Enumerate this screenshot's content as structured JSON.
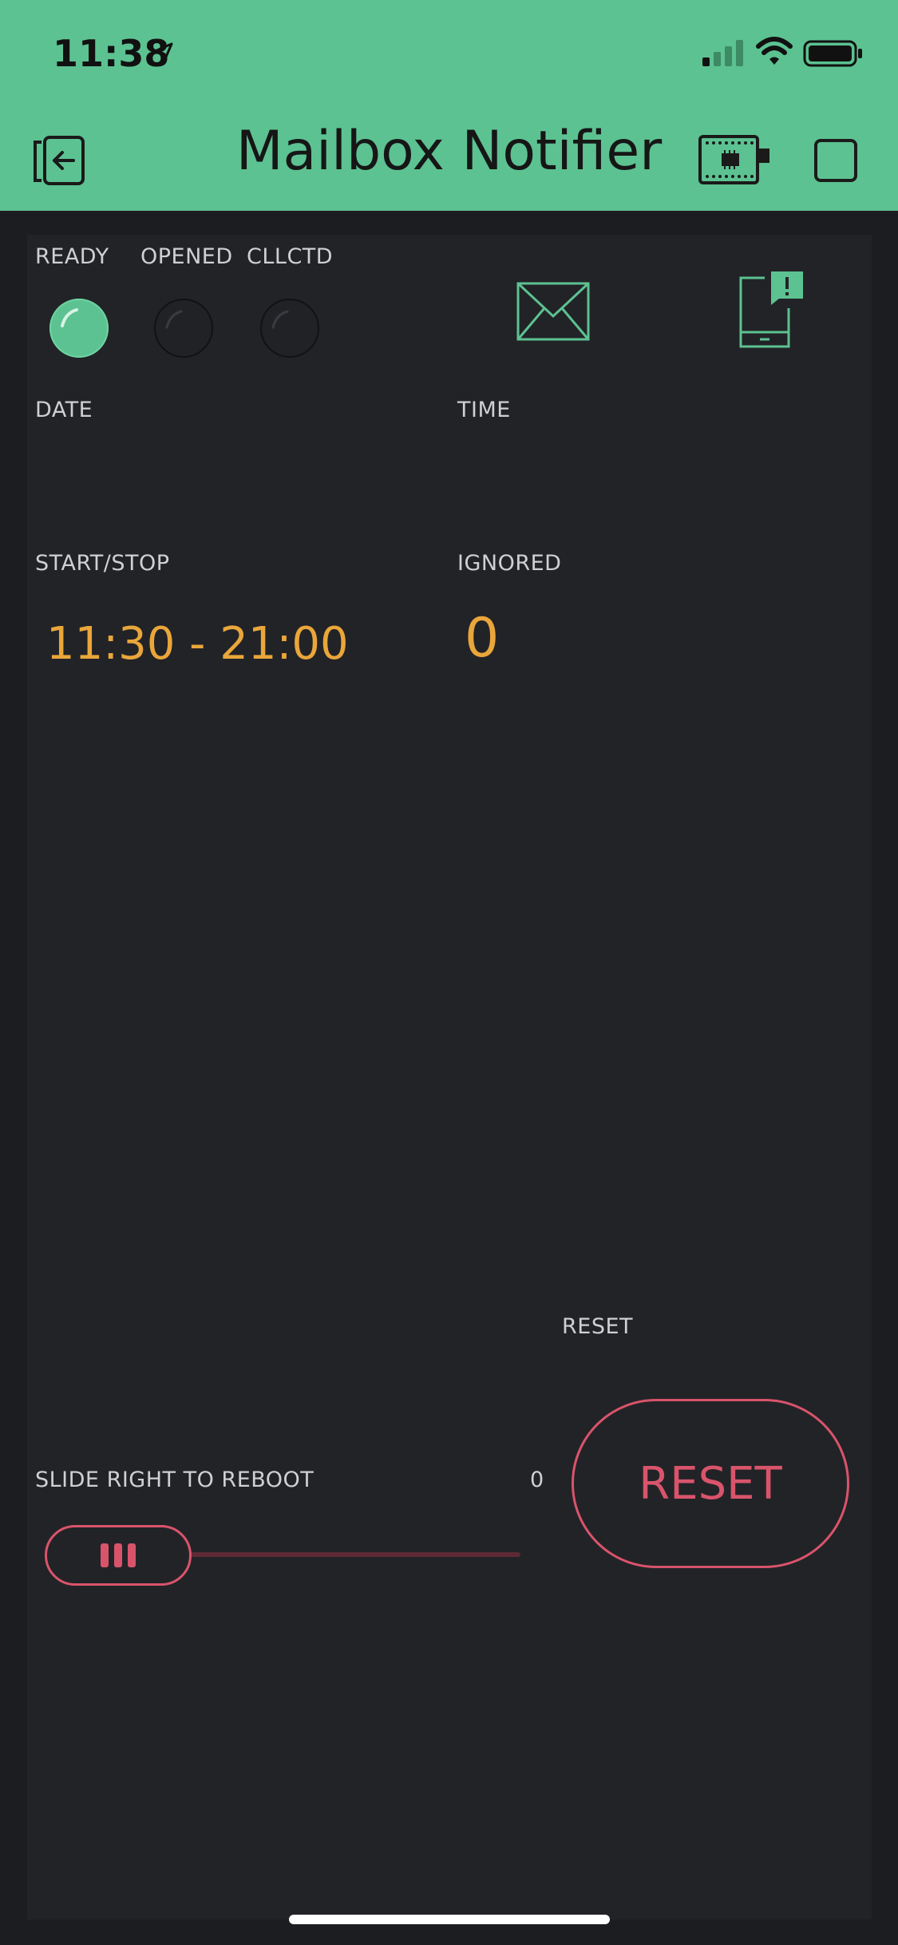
{
  "status_bar": {
    "time": "11:38"
  },
  "header": {
    "title": "Mailbox Notifier"
  },
  "leds": [
    {
      "label": "READY",
      "state": "on"
    },
    {
      "label": "OPENED",
      "state": "off"
    },
    {
      "label": "CLLCTD",
      "state": "off"
    }
  ],
  "fields": {
    "date_label": "DATE",
    "time_label": "TIME",
    "startstop_label": "START/STOP",
    "startstop_value": "11:30 - 21:00",
    "ignored_label": "IGNORED",
    "ignored_value": "0"
  },
  "reset": {
    "label_top": "RESET",
    "button_label": "RESET"
  },
  "reboot_slider": {
    "label": "SLIDE RIGHT TO REBOOT",
    "value": "0"
  },
  "colors": {
    "accent": "#5cc291",
    "value": "#e9a63a",
    "danger": "#d9546b",
    "background": "#1c1d21",
    "panel": "#222327"
  },
  "icons": [
    "back-icon",
    "device-icon",
    "square-icon",
    "mail-envelope-icon",
    "phone-notification-icon"
  ]
}
